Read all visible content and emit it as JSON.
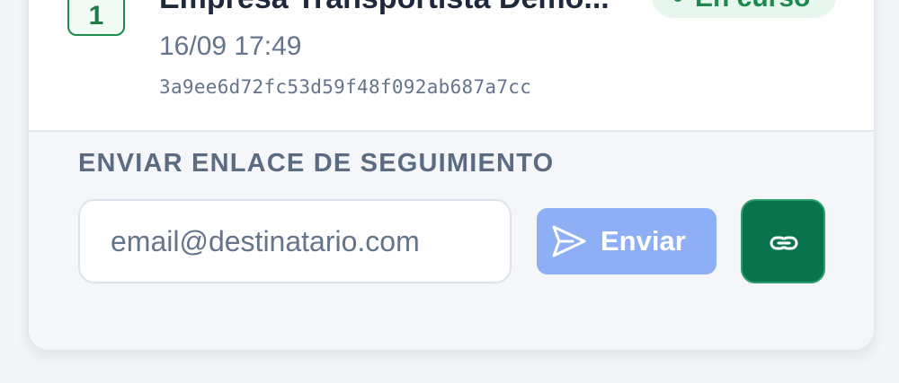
{
  "trip": {
    "number": "1",
    "company": "Empresa Transportista Demo...",
    "status": "En curso",
    "datetime": "16/09 17:49",
    "hash": "3a9ee6d72fc53d59f48f092ab687a7cc"
  },
  "share": {
    "title": "ENVIAR ENLACE DE SEGUIMIENTO",
    "email_placeholder": "email@destinatario.com",
    "email_value": "",
    "send_label": "Enviar",
    "send_icon": "send-icon",
    "link_icon": "link-icon"
  },
  "colors": {
    "accent_green": "#08734c",
    "status_green": "#1b8a4a",
    "send_blue": "#8eaef5",
    "text_muted": "#64748b"
  }
}
